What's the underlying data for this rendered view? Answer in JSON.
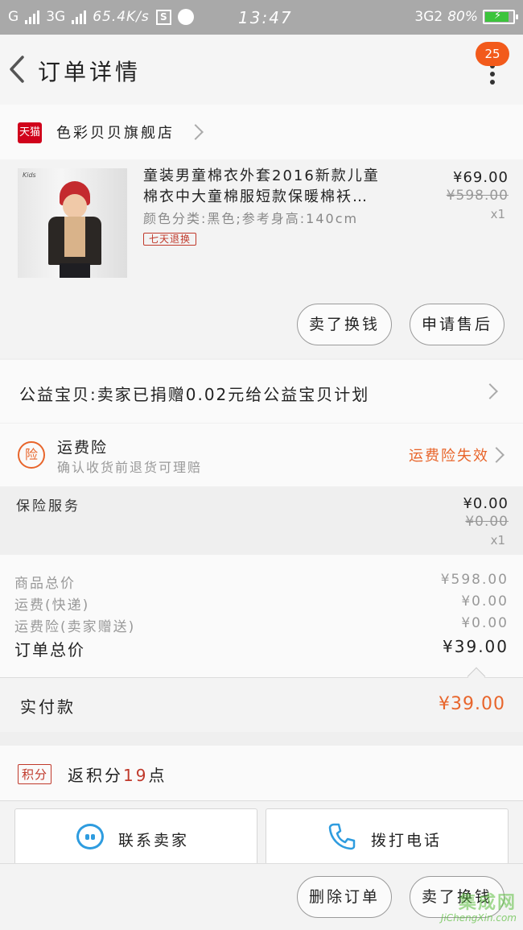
{
  "status_bar": {
    "carrier1": "G",
    "carrier2": "3G",
    "net_speed": "65.4K/s",
    "time": "13:47",
    "network_right": "3G2",
    "battery": "80%"
  },
  "header": {
    "title": "订单详情",
    "badge_count": "25"
  },
  "store": {
    "platform_icon_text": "天猫",
    "name": "色彩贝贝旗舰店"
  },
  "product": {
    "title": "童装男童棉衣外套2016新款儿童棉衣中大童棉服短款保暖棉袄…",
    "sku": "颜色分类:黑色;参考身高:140cm",
    "return_tag": "七天退换",
    "price": "¥69.00",
    "original_price": "¥598.00",
    "quantity": "x1",
    "thumb_brand": "Kids",
    "buttons": {
      "exchange": "卖了换钱",
      "after_sale": "申请售后"
    }
  },
  "charity": {
    "text": "公益宝贝:卖家已捐赠0.02元给公益宝贝计划"
  },
  "shipping_insurance": {
    "icon_text": "险",
    "title": "运费险",
    "subtitle": "确认收货前退货可理赔",
    "status": "运费险失效"
  },
  "insurance_service": {
    "label": "保险服务",
    "price": "¥0.00",
    "original_price": "¥0.00",
    "quantity": "x1"
  },
  "summary": {
    "goods_total_label": "商品总价",
    "goods_total": "¥598.00",
    "shipping_label": "运费(快递)",
    "shipping": "¥0.00",
    "insurance_label": "运费险(卖家赠送)",
    "insurance": "¥0.00",
    "order_total_label": "订单总价",
    "order_total": "¥39.00"
  },
  "paid": {
    "label": "实付款",
    "value": "¥39.00"
  },
  "points": {
    "badge": "积分",
    "prefix": "返积分",
    "count": "19",
    "suffix": "点"
  },
  "contact": {
    "seller": "联系卖家",
    "phone": "拨打电话"
  },
  "bottom_bar": {
    "delete_order": "删除订单",
    "exchange": "卖了换钱"
  },
  "watermark": {
    "brand": "集成网",
    "url": "JiChengXin.com"
  },
  "colors": {
    "accent_orange": "#e8652b",
    "tmall_red": "#d0021b",
    "chat_blue": "#2e9cdf"
  }
}
